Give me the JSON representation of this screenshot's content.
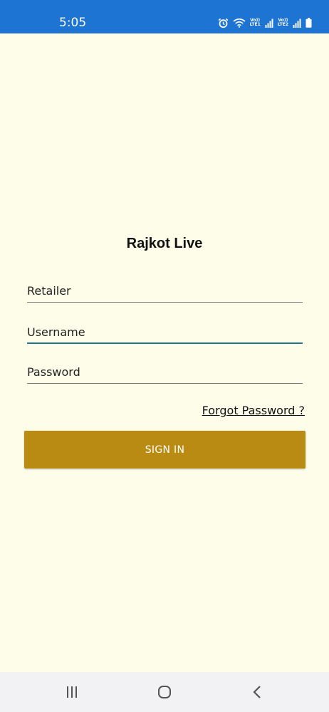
{
  "status_bar": {
    "time": "5:05",
    "icons": [
      "alarm-icon",
      "wifi-icon",
      "signal-icon",
      "signal-icon",
      "battery-icon"
    ],
    "sim1_label_top": "Vo))",
    "sim1_label_bottom": "LTE1",
    "sim2_label_top": "Vo))",
    "sim2_label_bottom": "LTE2",
    "background_color": "#1e74d3"
  },
  "login": {
    "title": "Rajkot Live",
    "retailer_placeholder": "Retailer",
    "username_placeholder": "Username",
    "password_placeholder": "Password",
    "forgot_password": "Forgot Password ?",
    "signin_label": "SIGN IN"
  },
  "colors": {
    "background": "#fefde9",
    "button": "#b98b12",
    "focus_underline": "#1d7690"
  },
  "nav_bar": {
    "buttons": [
      "recent-apps-icon",
      "home-icon",
      "back-icon"
    ]
  }
}
